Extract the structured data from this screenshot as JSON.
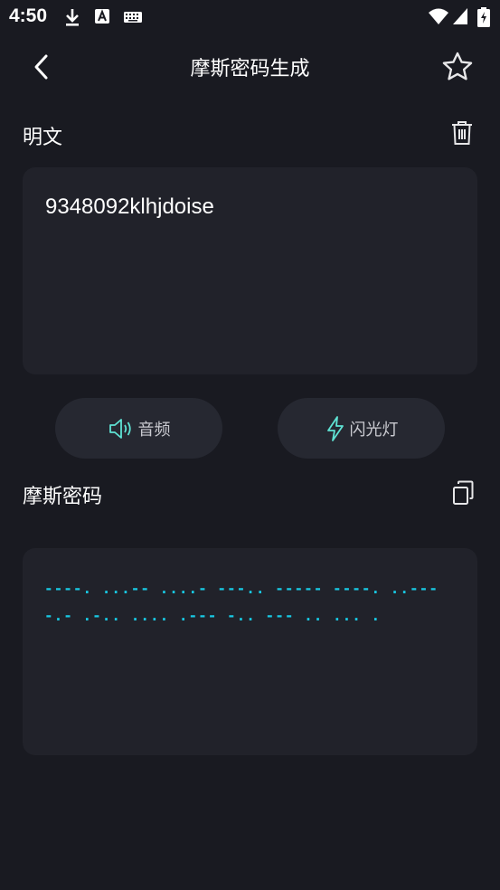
{
  "status_bar": {
    "time": "4:50",
    "icons": [
      "download-icon",
      "font-a-icon",
      "keyboard-icon",
      "wifi-icon",
      "signal-icon",
      "battery-charging-icon"
    ]
  },
  "app_bar": {
    "title": "摩斯密码生成",
    "back_icon": "chevron-left-icon",
    "favorite_icon": "star-outline-icon"
  },
  "plaintext": {
    "label": "明文",
    "value": "9348092klhjdoise",
    "clear_icon": "trash-icon"
  },
  "actions": {
    "audio_label": "音频",
    "audio_icon": "speaker-icon",
    "flash_label": "闪光灯",
    "flash_icon": "lightning-icon"
  },
  "morse": {
    "label": "摩斯密码",
    "copy_icon": "copy-icon",
    "value": "----. ...-- ....- ---.. ----- ----. ..--- -.- .-.. .... .--- -.. --- .. ... ."
  },
  "colors": {
    "background": "#191a21",
    "panel": "#21222a",
    "button": "#262831",
    "morse_text": "#18c7e1"
  }
}
